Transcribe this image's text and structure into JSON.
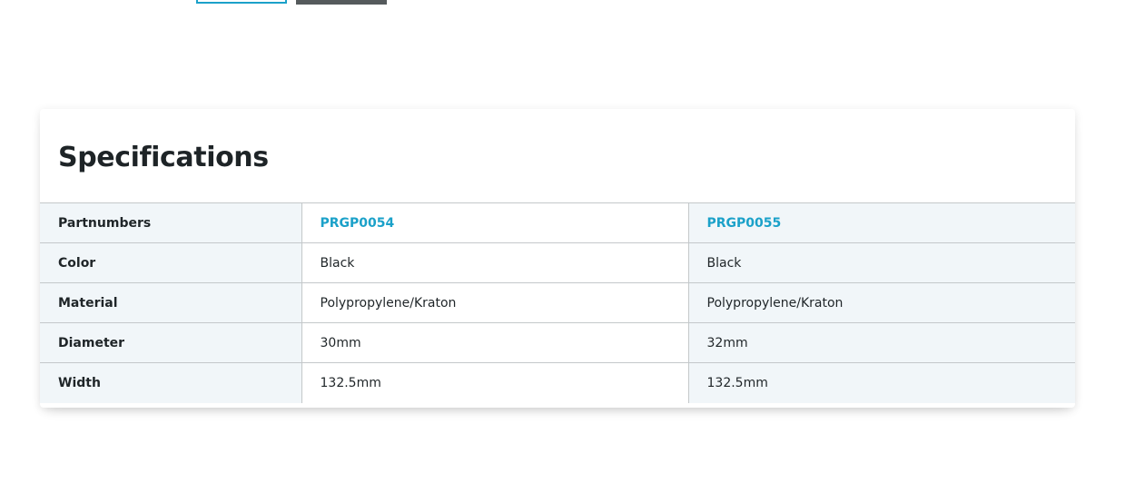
{
  "top_buttons": [
    "",
    ""
  ],
  "specifications": {
    "title": "Specifications",
    "rows": [
      {
        "label": "Partnumbers",
        "values": [
          "PRGP0054",
          "PRGP0055"
        ]
      },
      {
        "label": "Color",
        "values": [
          "Black",
          "Black"
        ]
      },
      {
        "label": "Material",
        "values": [
          "Polypropylene/Kraton",
          "Polypropylene/Kraton"
        ]
      },
      {
        "label": "Diameter",
        "values": [
          "30mm",
          "32mm"
        ]
      },
      {
        "label": "Width",
        "values": [
          "132.5mm",
          "132.5mm"
        ]
      }
    ]
  },
  "colors": {
    "accent": "#1ba1c9",
    "row_tint": "#f1f6f9",
    "border": "#c4c8ca"
  }
}
